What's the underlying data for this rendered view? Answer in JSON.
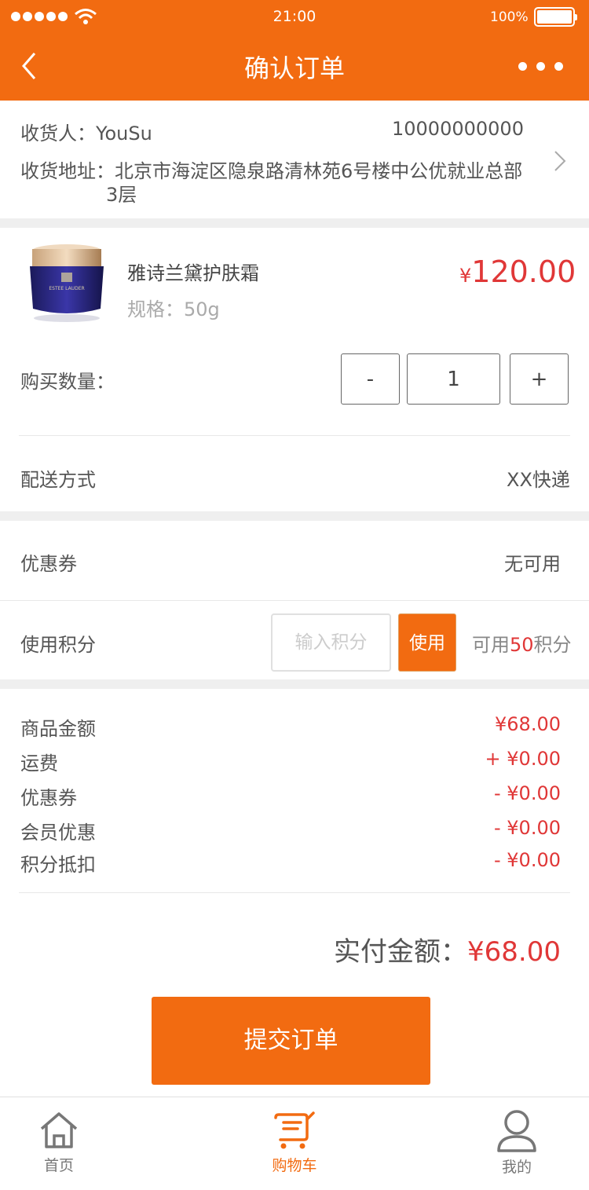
{
  "status": {
    "time": "21:00",
    "battery": "100%"
  },
  "header": {
    "title": "确认订单"
  },
  "address": {
    "receiver_label": "收货人：",
    "receiver_name": "YouSu",
    "phone": "10000000000",
    "address_label": "收货地址：",
    "address_line1": "北京市海淀区隐泉路清林苑6号楼中公优就业总部",
    "address_line2": "3层"
  },
  "product": {
    "name": "雅诗兰黛护肤霜",
    "spec": "规格：50g",
    "currency": "¥",
    "price": "120.00",
    "image_text": "ESTEE LAUDER"
  },
  "quantity": {
    "label": "购买数量：",
    "minus": "-",
    "value": "1",
    "plus": "+"
  },
  "delivery": {
    "label": "配送方式",
    "value": "XX快递"
  },
  "coupon": {
    "label": "优惠券",
    "value": "无可用"
  },
  "points": {
    "label": "使用积分",
    "placeholder": "输入积分",
    "use_button": "使用",
    "available_prefix": "可用",
    "available_value": "50",
    "available_suffix": "积分"
  },
  "summary": [
    {
      "label": "商品金额",
      "value": "¥68.00"
    },
    {
      "label": "运费",
      "value": "+ ¥0.00"
    },
    {
      "label": "优惠券",
      "value": "- ¥0.00"
    },
    {
      "label": "会员优惠",
      "value": "- ¥0.00"
    },
    {
      "label": "积分抵扣",
      "value": "- ¥0.00"
    }
  ],
  "total": {
    "label": "实付金额：",
    "value": "¥68.00"
  },
  "submit": {
    "label": "提交订单"
  },
  "tabbar": [
    {
      "label": "首页",
      "icon": "home-icon"
    },
    {
      "label": "购物车",
      "icon": "cart-icon"
    },
    {
      "label": "我的",
      "icon": "user-icon"
    }
  ],
  "colors": {
    "accent": "#f26b11",
    "price": "#e03737"
  }
}
